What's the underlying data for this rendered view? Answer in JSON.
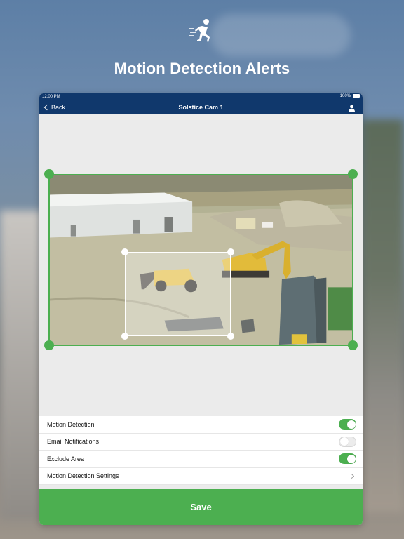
{
  "hero": {
    "icon": "running-person-icon",
    "title": "Motion Detection Alerts"
  },
  "status_bar": {
    "time": "12:00 PM",
    "battery": "100%"
  },
  "nav": {
    "back_label": "Back",
    "title": "Solstice Cam 1",
    "user_icon": "user-icon"
  },
  "colors": {
    "nav_bg": "#10386c",
    "accent_green": "#4caf50"
  },
  "settings": [
    {
      "label": "Motion Detection",
      "control": "toggle",
      "on": true
    },
    {
      "label": "Email Notifications",
      "control": "toggle",
      "on": false
    },
    {
      "label": "Exclude Area",
      "control": "toggle",
      "on": true
    },
    {
      "label": "Motion Detection Settings",
      "control": "chevron"
    }
  ],
  "save_label": "Save"
}
